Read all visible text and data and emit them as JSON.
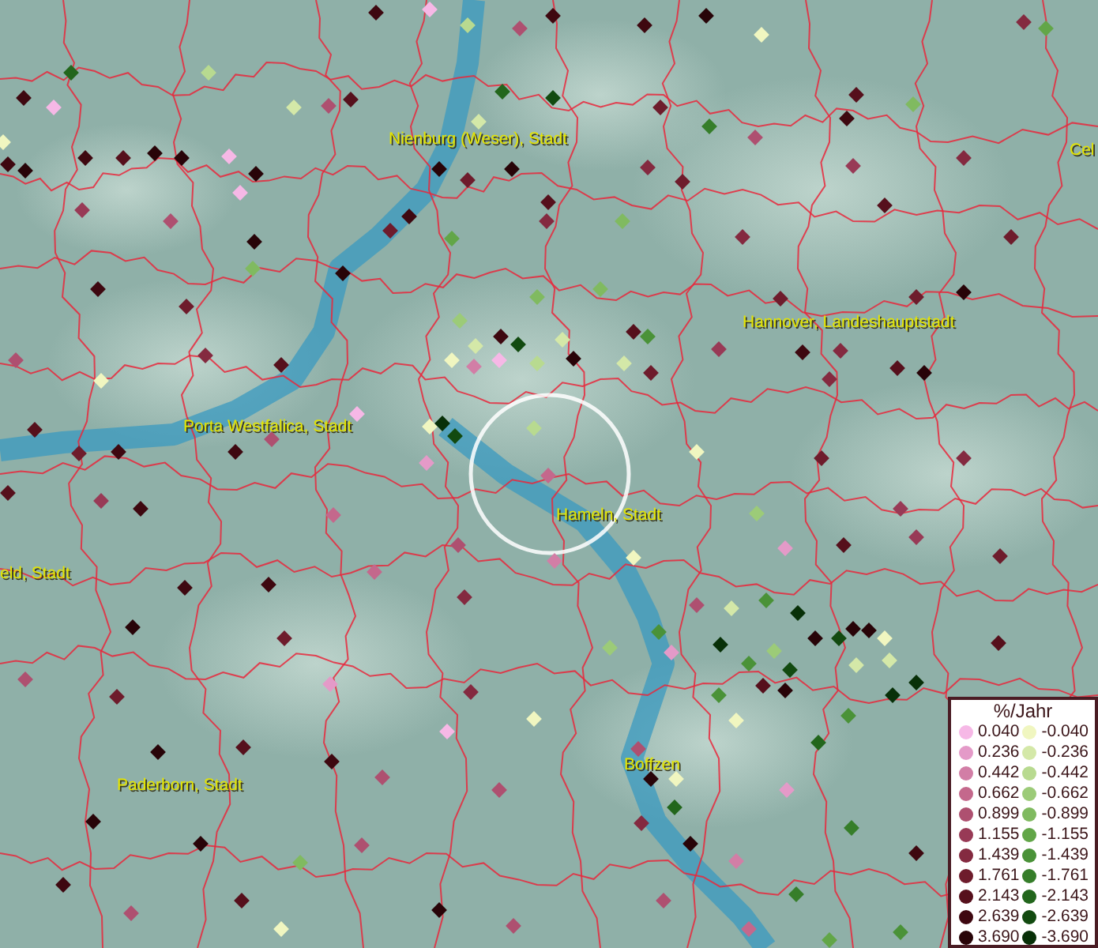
{
  "map": {
    "labels": [
      {
        "text": "Nienburg (Weser), Stadt"
      },
      {
        "text": "Cel"
      },
      {
        "text": "Hannover, Landeshauptstadt"
      },
      {
        "text": "Porta Westfalica, Stadt"
      },
      {
        "text": "Hameln, Stadt"
      },
      {
        "text": "eld, Stadt"
      },
      {
        "text": "Paderborn, Stadt"
      },
      {
        "text": "Boffzen"
      }
    ]
  },
  "legend": {
    "title": "%/Jahr",
    "positive": [
      {
        "label": "0.040",
        "color": "#f6b8e6"
      },
      {
        "label": "0.236",
        "color": "#e49ac8"
      },
      {
        "label": "0.442",
        "color": "#d27ea6"
      },
      {
        "label": "0.662",
        "color": "#c4688c"
      },
      {
        "label": "0.899",
        "color": "#ae5070"
      },
      {
        "label": "1.155",
        "color": "#983a56"
      },
      {
        "label": "1.439",
        "color": "#842a40"
      },
      {
        "label": "1.761",
        "color": "#6e1c2c"
      },
      {
        "label": "2.143",
        "color": "#56101c"
      },
      {
        "label": "2.639",
        "color": "#3e0810"
      },
      {
        "label": "3.690",
        "color": "#280408"
      }
    ],
    "negative": [
      {
        "label": "-0.040",
        "color": "#f0f6c0"
      },
      {
        "label": "-0.236",
        "color": "#d4e8a8"
      },
      {
        "label": "-0.442",
        "color": "#b8da90"
      },
      {
        "label": "-0.662",
        "color": "#9ccb78"
      },
      {
        "label": "-0.899",
        "color": "#80ba60"
      },
      {
        "label": "-1.155",
        "color": "#62a648"
      },
      {
        "label": "-1.439",
        "color": "#4a9238"
      },
      {
        "label": "-1.761",
        "color": "#367e2a"
      },
      {
        "label": "-2.143",
        "color": "#22661c"
      },
      {
        "label": "-2.639",
        "color": "#124a10"
      },
      {
        "label": "-3.690",
        "color": "#083008"
      }
    ]
  }
}
